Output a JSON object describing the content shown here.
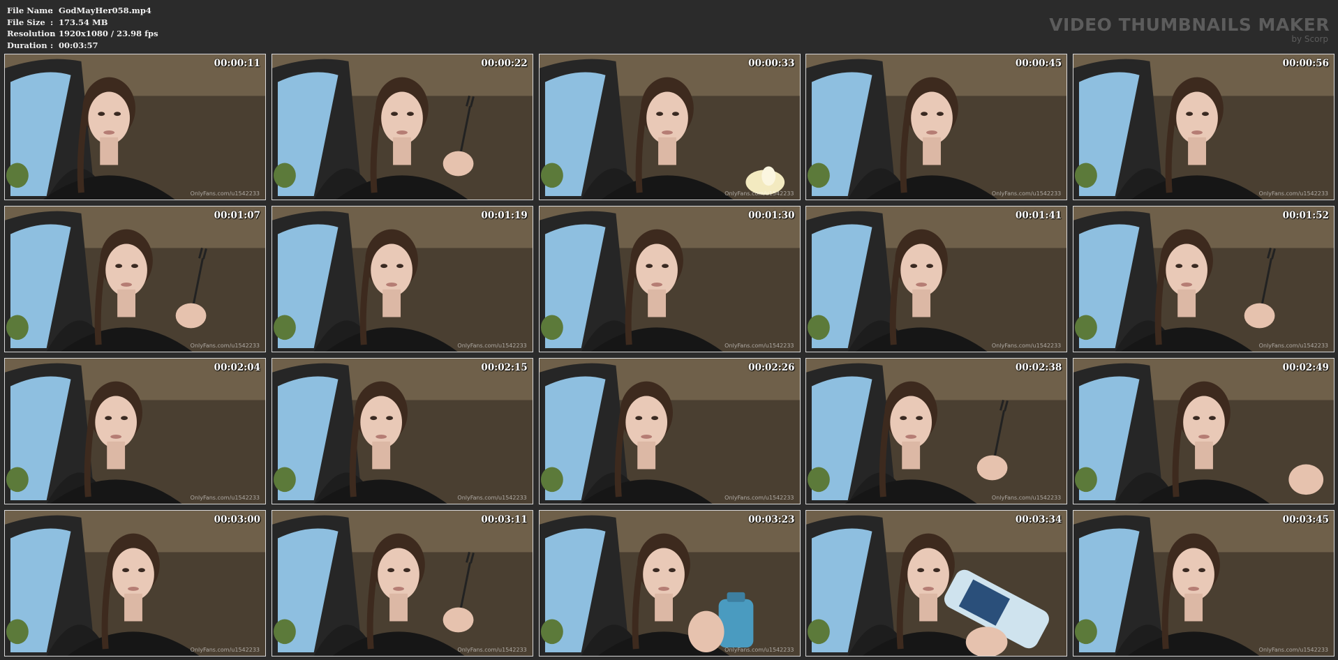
{
  "file_info": [
    {
      "label": "File Name",
      "sep": ":",
      "value": "GodMayHer058.mp4"
    },
    {
      "label": "File Size",
      "sep": ":",
      "value": "173.54 MB"
    },
    {
      "label": "Resolution",
      "sep": ":",
      "value": "1920x1080 / 23.98 fps"
    },
    {
      "label": "Duration",
      "sep": ":",
      "value": "00:03:57"
    }
  ],
  "brand": {
    "title": "VIDEO THUMBNAILS MAKER",
    "subtitle": "by Scorp"
  },
  "colors": {
    "background": "#2b2b2b",
    "border": "#d8d8d8",
    "brand": "#5c5c5c"
  },
  "thumbnails": [
    {
      "time": "00:00:11",
      "prop": "none",
      "watermark": "OnlyFans.com/u1542233"
    },
    {
      "time": "00:00:22",
      "prop": "fork",
      "watermark": ""
    },
    {
      "time": "00:00:33",
      "prop": "food",
      "watermark": "OnlyFans.com/u1542233"
    },
    {
      "time": "00:00:45",
      "prop": "none",
      "watermark": "OnlyFans.com/u1542233"
    },
    {
      "time": "00:00:56",
      "prop": "none",
      "watermark": "OnlyFans.com/u1542233"
    },
    {
      "time": "00:01:07",
      "prop": "fork",
      "watermark": "OnlyFans.com/u1542233"
    },
    {
      "time": "00:01:19",
      "prop": "none",
      "watermark": "OnlyFans.com/u1542233"
    },
    {
      "time": "00:01:30",
      "prop": "none",
      "watermark": "OnlyFans.com/u1542233"
    },
    {
      "time": "00:01:41",
      "prop": "none",
      "watermark": "OnlyFans.com/u1542233"
    },
    {
      "time": "00:01:52",
      "prop": "fork",
      "watermark": "OnlyFans.com/u1542233"
    },
    {
      "time": "00:02:04",
      "prop": "none",
      "watermark": "OnlyFans.com/u1542233"
    },
    {
      "time": "00:02:15",
      "prop": "none",
      "watermark": "OnlyFans.com/u1542233"
    },
    {
      "time": "00:02:26",
      "prop": "none",
      "watermark": "OnlyFans.com/u1542233"
    },
    {
      "time": "00:02:38",
      "prop": "fork",
      "watermark": "OnlyFans.com/u1542233"
    },
    {
      "time": "00:02:49",
      "prop": "hand",
      "watermark": ""
    },
    {
      "time": "00:03:00",
      "prop": "none",
      "watermark": "OnlyFans.com/u1542233"
    },
    {
      "time": "00:03:11",
      "prop": "fork",
      "watermark": "OnlyFans.com/u1542233"
    },
    {
      "time": "00:03:23",
      "prop": "bottle",
      "watermark": "OnlyFans.com/u1542233"
    },
    {
      "time": "00:03:34",
      "prop": "bottle-drink",
      "watermark": ""
    },
    {
      "time": "00:03:45",
      "prop": "none",
      "watermark": "OnlyFans.com/u1542233"
    }
  ]
}
